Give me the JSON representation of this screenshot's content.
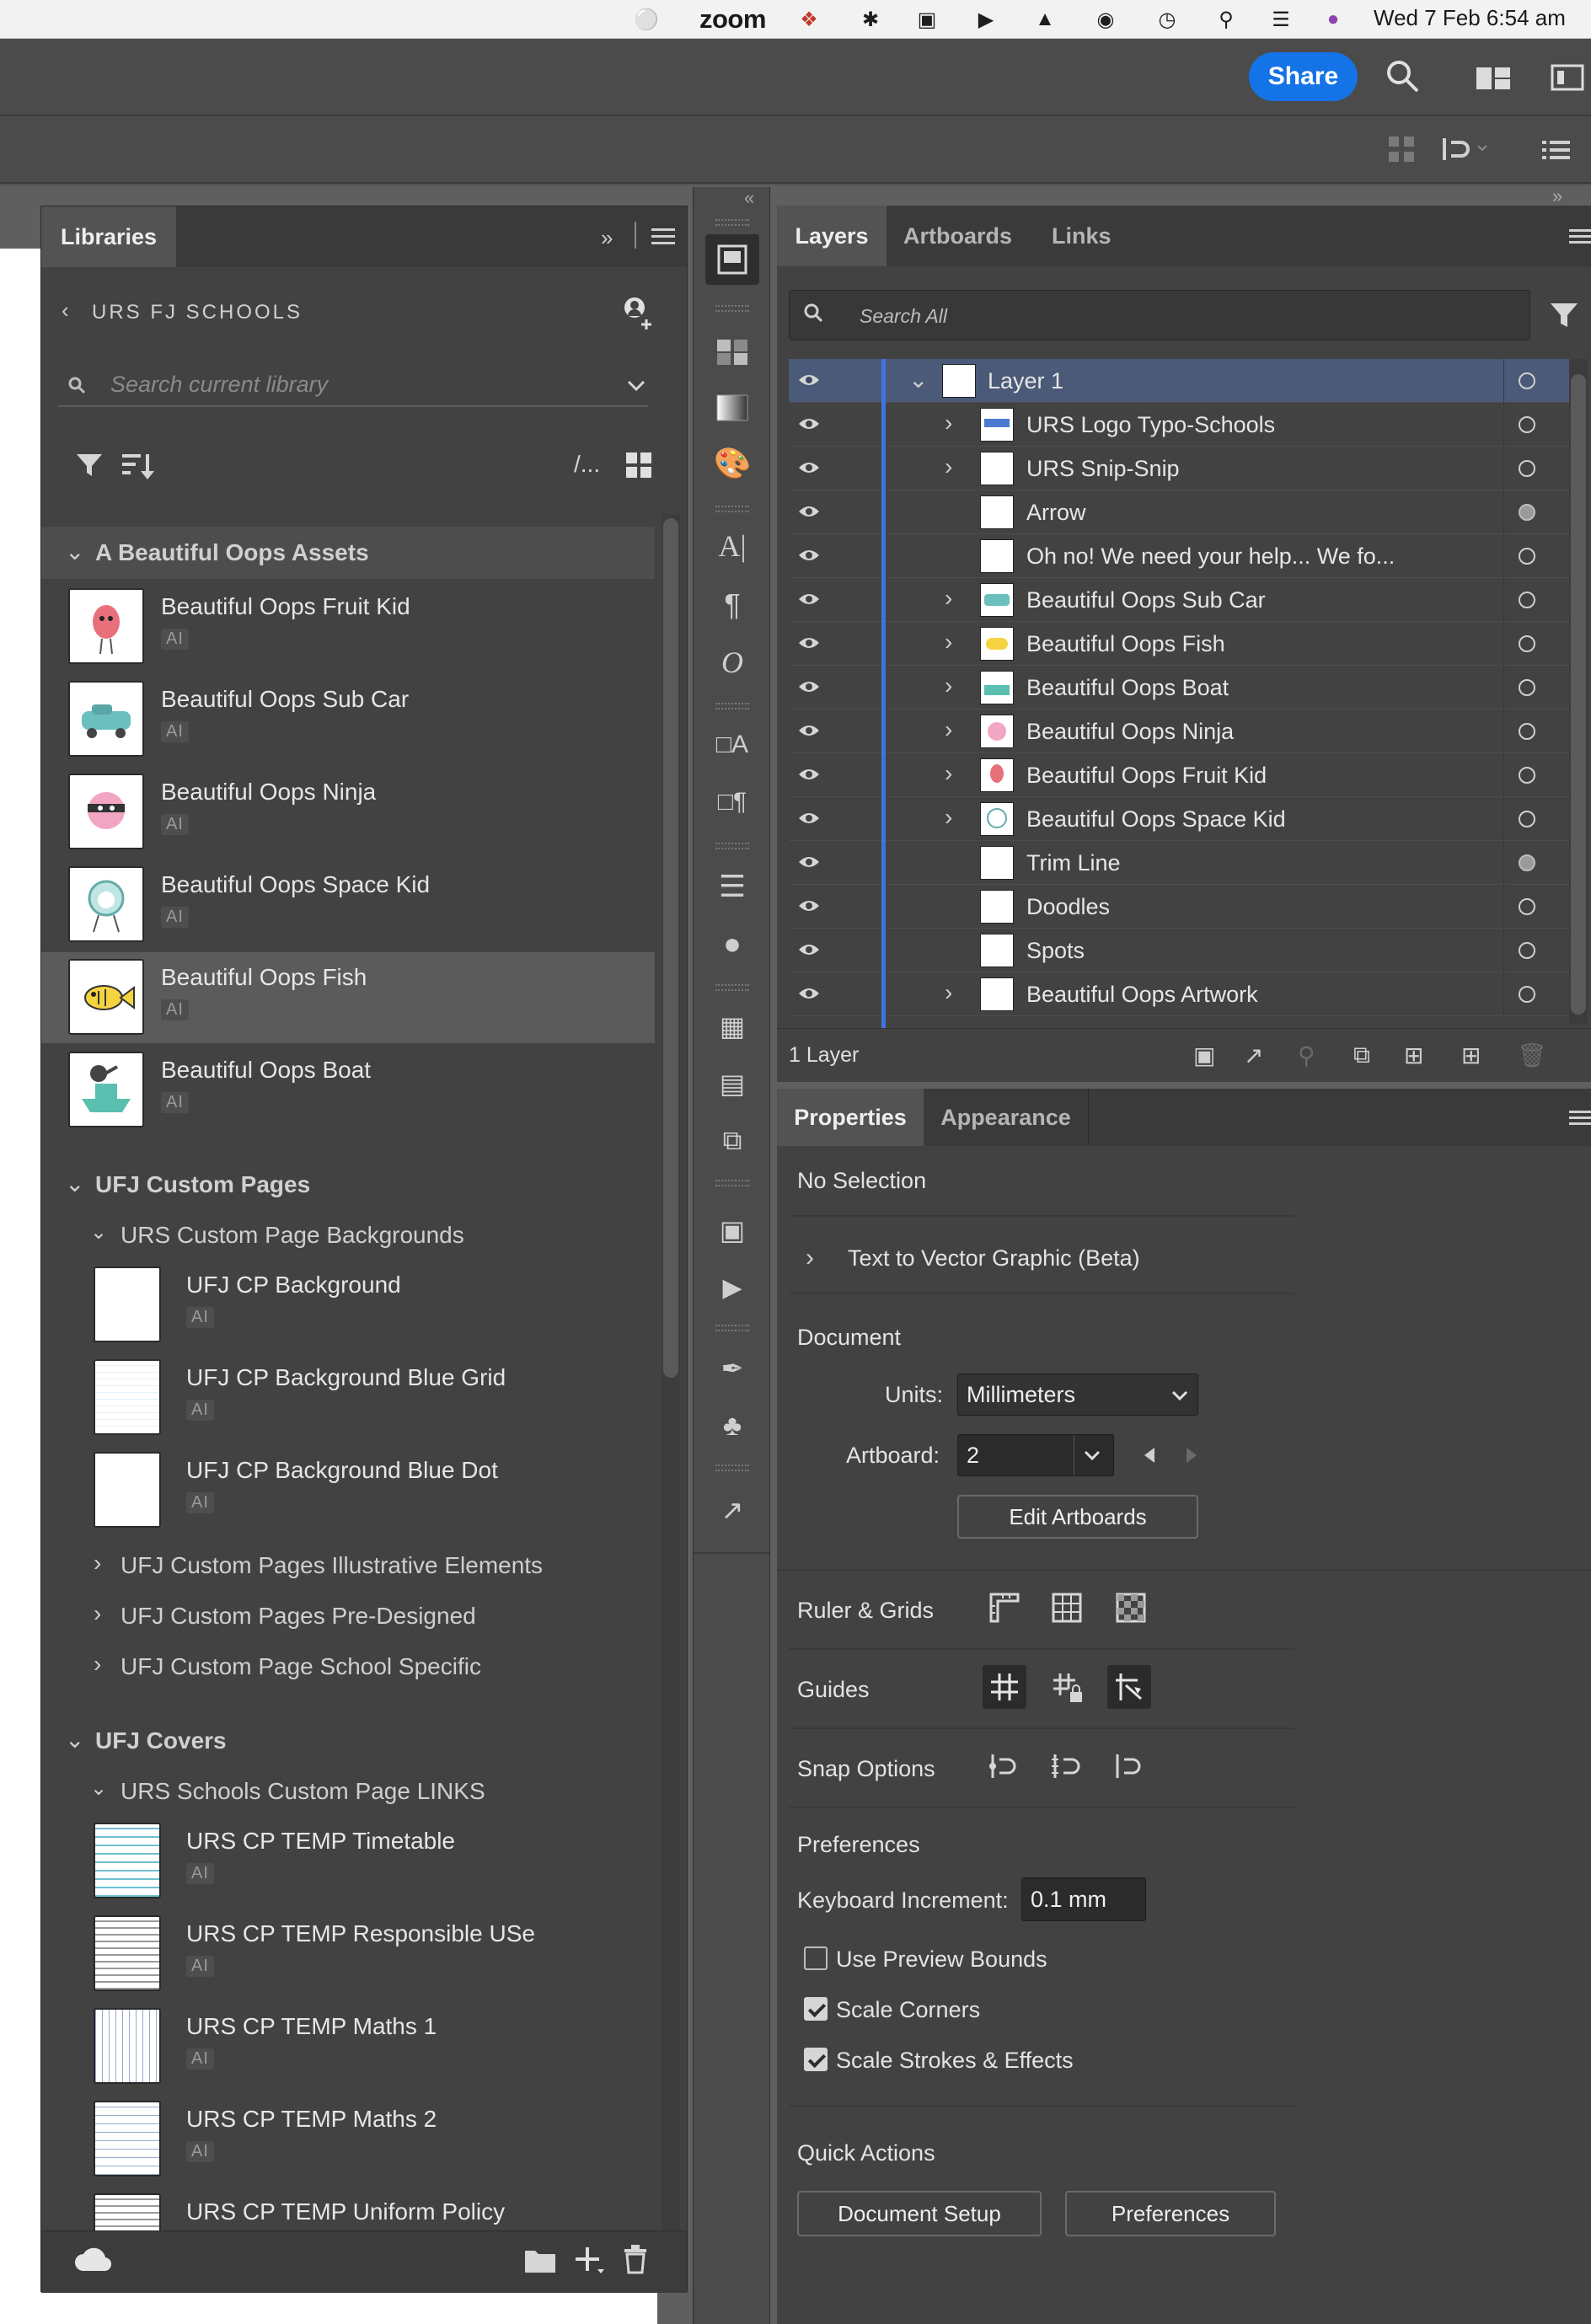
{
  "menubar": {
    "zoom": "zoom",
    "clock": "Wed 7 Feb  6:54 am"
  },
  "appbar": {
    "share": "Share"
  },
  "libraries": {
    "tab": "Libraries",
    "library_name": "URS FJ SCHOOLS",
    "search_placeholder": "Search current library",
    "view_toggle": "/...",
    "group1": {
      "title": "A Beautiful Oops Assets",
      "items": [
        {
          "name": "Beautiful Oops Fruit Kid",
          "type": "AI"
        },
        {
          "name": "Beautiful Oops Sub Car",
          "type": "AI"
        },
        {
          "name": "Beautiful Oops Ninja",
          "type": "AI"
        },
        {
          "name": "Beautiful Oops Space Kid",
          "type": "AI"
        },
        {
          "name": "Beautiful Oops Fish",
          "type": "AI"
        },
        {
          "name": "Beautiful Oops Boat",
          "type": "AI"
        }
      ]
    },
    "group2": {
      "title": "UFJ Custom Pages",
      "sub_open": "URS Custom Page Backgrounds",
      "items": [
        {
          "name": "UFJ CP Background",
          "type": "AI"
        },
        {
          "name": "UFJ CP Background Blue Grid",
          "type": "AI"
        },
        {
          "name": "UFJ CP Background Blue Dot",
          "type": "AI"
        }
      ],
      "collapsed": [
        "UFJ Custom Pages Illustrative Elements",
        "UFJ Custom Pages Pre-Designed",
        "UFJ Custom Page School Specific"
      ]
    },
    "group3": {
      "title": "UFJ Covers",
      "sub_open": "URS Schools Custom Page LINKS",
      "items": [
        {
          "name": "URS CP TEMP Timetable",
          "type": "AI"
        },
        {
          "name": "URS CP TEMP Responsible USe",
          "type": "AI"
        },
        {
          "name": "URS CP TEMP Maths 1",
          "type": "AI"
        },
        {
          "name": "URS CP TEMP Maths 2",
          "type": "AI"
        },
        {
          "name": "URS CP TEMP Uniform Policy",
          "type": ""
        }
      ]
    }
  },
  "layers": {
    "tabs": [
      "Layers",
      "Artboards",
      "Links"
    ],
    "search_placeholder": "Search All",
    "rows": [
      {
        "name": "Layer 1"
      },
      {
        "name": "URS Logo Typo-Schools"
      },
      {
        "name": "URS Snip-Snip"
      },
      {
        "name": "Arrow"
      },
      {
        "name": "Oh no! We need your help... We fo..."
      },
      {
        "name": "Beautiful Oops Sub Car"
      },
      {
        "name": "Beautiful Oops Fish"
      },
      {
        "name": "Beautiful Oops Boat"
      },
      {
        "name": "Beautiful Oops Ninja"
      },
      {
        "name": "Beautiful Oops Fruit Kid"
      },
      {
        "name": "Beautiful Oops Space Kid"
      },
      {
        "name": "Trim Line"
      },
      {
        "name": "Doodles"
      },
      {
        "name": "Spots"
      },
      {
        "name": "Beautiful Oops Artwork"
      }
    ],
    "footer": "1 Layer"
  },
  "properties": {
    "tabs": [
      "Properties",
      "Appearance"
    ],
    "no_selection": "No Selection",
    "text_to_vector": "Text to Vector Graphic (Beta)",
    "document": "Document",
    "units_label": "Units:",
    "units_value": "Millimeters",
    "artboard_label": "Artboard:",
    "artboard_value": "2",
    "edit_artboards": "Edit Artboards",
    "ruler_grids": "Ruler & Grids",
    "guides": "Guides",
    "snap_options": "Snap Options",
    "preferences": "Preferences",
    "keyboard_increment_label": "Keyboard Increment:",
    "keyboard_increment_value": "0.1 mm",
    "use_preview_bounds": "Use Preview Bounds",
    "scale_corners": "Scale Corners",
    "scale_strokes": "Scale Strokes & Effects",
    "quick_actions": "Quick Actions",
    "document_setup_btn": "Document Setup",
    "preferences_btn": "Preferences"
  }
}
